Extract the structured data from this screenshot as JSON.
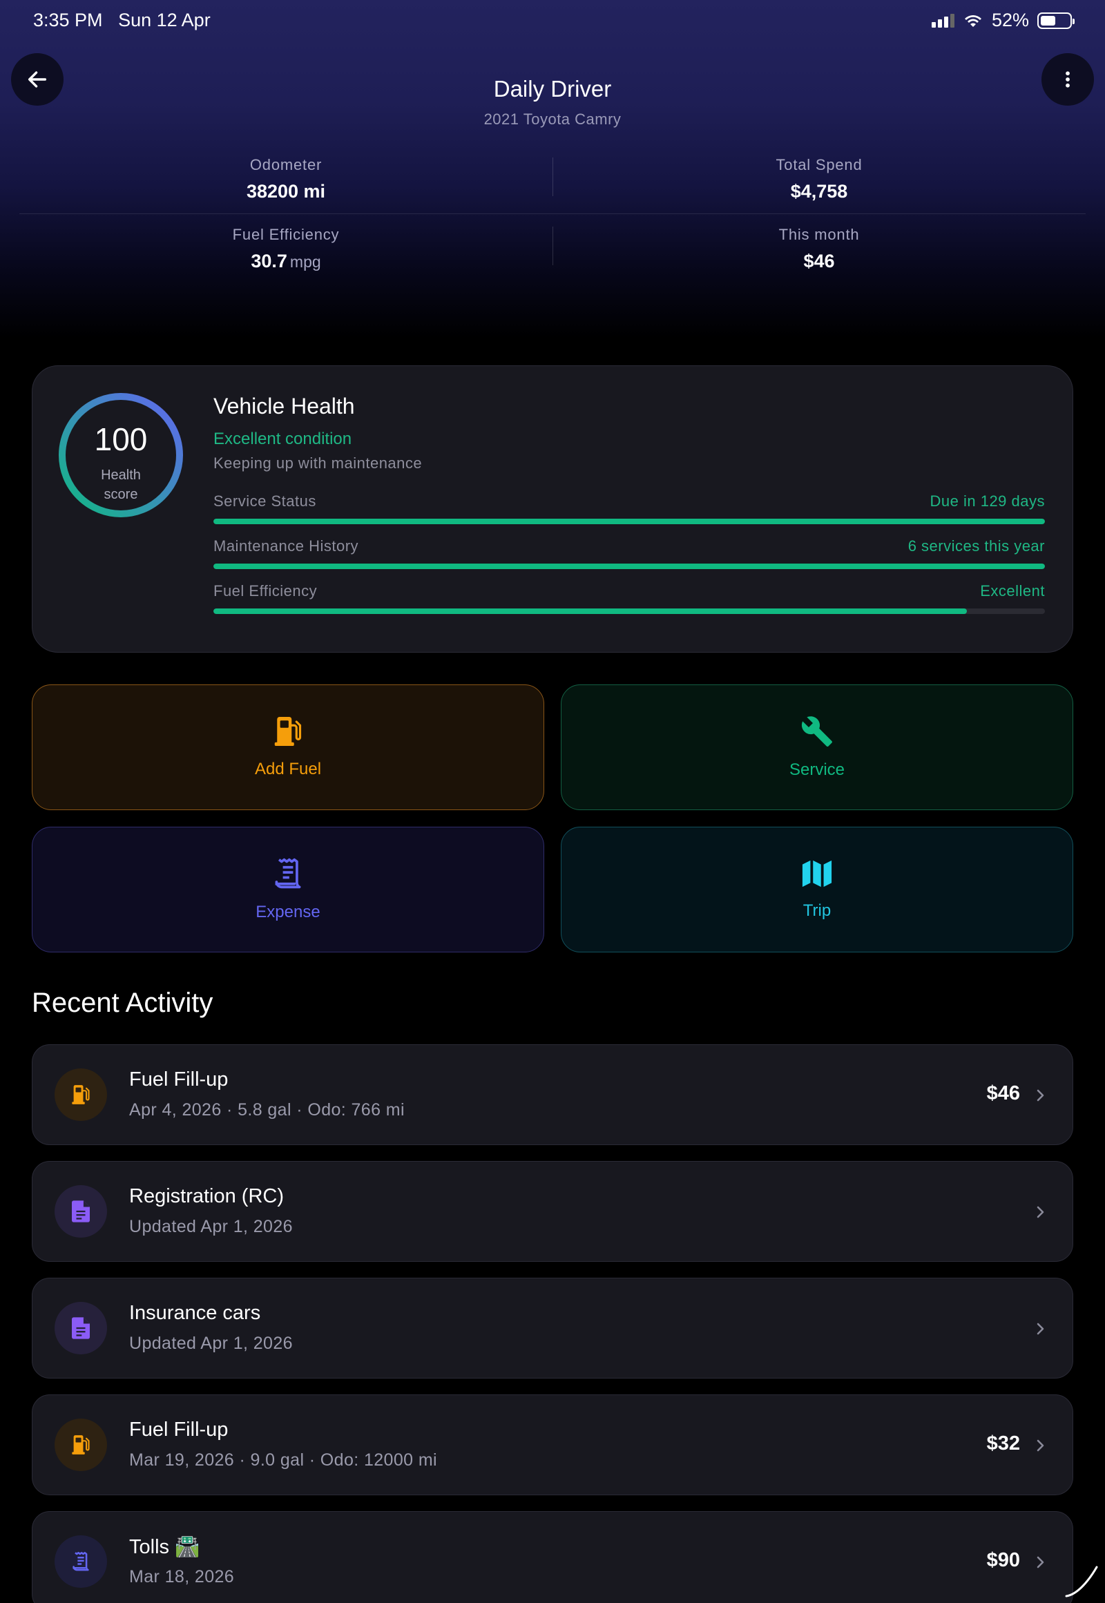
{
  "status_bar": {
    "time": "3:35 PM",
    "date": "Sun 12 Apr",
    "battery": "52%"
  },
  "header": {
    "title": "Daily Driver",
    "subtitle": "2021 Toyota Camry",
    "back_icon": "arrow-left-icon",
    "more_icon": "more-vertical-icon"
  },
  "stats": {
    "odometer_label": "Odometer",
    "odometer_value": "38200 mi",
    "spend_label": "Total Spend",
    "spend_value": "$4,758",
    "efficiency_label": "Fuel Efficiency",
    "efficiency_value": "30.7",
    "efficiency_unit": "mpg",
    "month_label": "This month",
    "month_value": "$46"
  },
  "health": {
    "score": "100",
    "score_label_1": "Health",
    "score_label_2": "score",
    "title": "Vehicle Health",
    "status": "Excellent condition",
    "subtitle": "Keeping up with maintenance",
    "metrics": [
      {
        "label": "Service Status",
        "value": "Due in 129 days",
        "progress": 1.0
      },
      {
        "label": "Maintenance History",
        "value": "6 services this year",
        "progress": 1.0
      },
      {
        "label": "Fuel Efficiency",
        "value": "Excellent",
        "progress": 0.906
      }
    ],
    "colors": {
      "accent": "#10b981",
      "gauge_start": "#10b981",
      "gauge_end": "#6366f1"
    }
  },
  "actions": {
    "fuel": {
      "label": "Add Fuel",
      "icon": "fuel-pump-icon",
      "color": "#f59e0b"
    },
    "service": {
      "label": "Service",
      "icon": "wrench-icon",
      "color": "#10b981"
    },
    "expense": {
      "label": "Expense",
      "icon": "receipt-icon",
      "color": "#6366f1"
    },
    "trip": {
      "label": "Trip",
      "icon": "map-icon",
      "color": "#22d3ee"
    }
  },
  "recent": {
    "title": "Recent Activity",
    "items": [
      {
        "title": "Fuel Fill-up",
        "subtitle": "Apr 4, 2026 · 5.8 gal · Odo: 766 mi",
        "amount": "$46",
        "icon": "fuel-pump-icon"
      },
      {
        "title": "Registration (RC)",
        "subtitle": "Updated Apr 1, 2026",
        "amount": "",
        "icon": "document-icon"
      },
      {
        "title": "Insurance cars",
        "subtitle": "Updated Apr 1, 2026",
        "amount": "",
        "icon": "document-icon"
      },
      {
        "title": "Fuel Fill-up",
        "subtitle": "Mar 19, 2026 · 9.0 gal · Odo: 12000 mi",
        "amount": "$32",
        "icon": "fuel-pump-icon"
      },
      {
        "title": "Tolls 🛣️",
        "subtitle": "Mar 18, 2026",
        "amount": "$90",
        "icon": "receipt-icon"
      }
    ]
  }
}
